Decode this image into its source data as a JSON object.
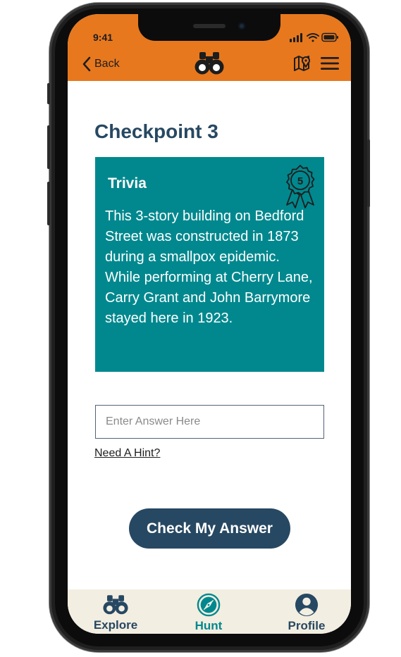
{
  "status_bar": {
    "time": "9:41"
  },
  "header": {
    "back_label": "Back",
    "logo_icon": "binoculars-icon",
    "map_icon": "map-pin-icon",
    "menu_icon": "hamburger-menu-icon"
  },
  "main": {
    "title": "Checkpoint 3",
    "card": {
      "label": "Trivia",
      "badge_value": "5",
      "text": "This 3-story building on Bedford Street was constructed in 1873 during a smallpox epidemic. While performing at Cherry Lane, Carry Grant and John Barrymore stayed here in 1923."
    },
    "answer_placeholder": "Enter Answer Here",
    "hint_label": "Need A Hint?",
    "submit_label": "Check My Answer"
  },
  "tabbar": {
    "items": [
      {
        "label": "Explore",
        "icon": "binoculars-icon",
        "active": false
      },
      {
        "label": "Hunt",
        "icon": "compass-icon",
        "active": true
      },
      {
        "label": "Profile",
        "icon": "user-circle-icon",
        "active": false
      }
    ]
  },
  "colors": {
    "header": "#e7781e",
    "card": "#00888e",
    "navy": "#274862",
    "tabbar": "#f2eee1",
    "active_tab": "#00888e"
  }
}
